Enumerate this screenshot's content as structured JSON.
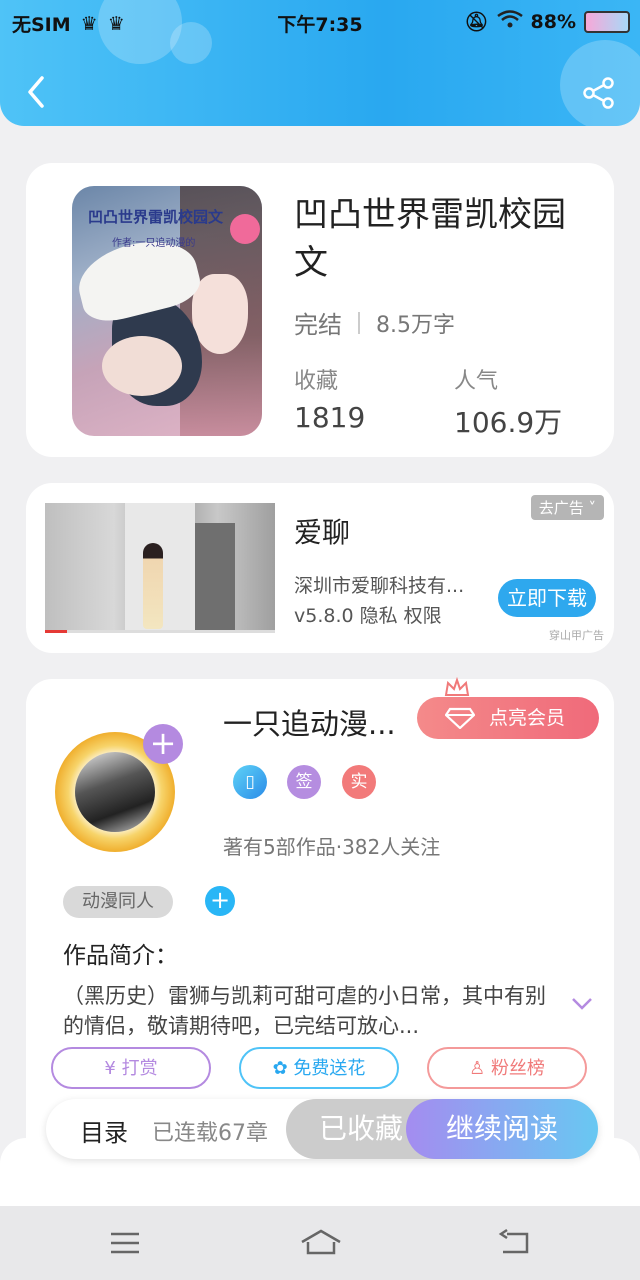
{
  "status_bar": {
    "carrier": "无SIM",
    "time": "下午7:35",
    "battery": "88%"
  },
  "book": {
    "cover_title": "凹凸世界雷凯校园文",
    "cover_author": "作者:一只追动漫的",
    "title": "凹凸世界雷凯校园文",
    "status": "完结",
    "word_count": "8.5万字",
    "favorites_label": "收藏",
    "favorites_value": "1819",
    "popularity_label": "人气",
    "popularity_value": "106.9万"
  },
  "ad": {
    "app_name": "爱聊",
    "company": "深圳市爱聊科技有...",
    "version_line": "v5.8.0  隐私  权限",
    "dismiss_label": "去广告",
    "download_label": "立即下载",
    "source": "穿山甲广告"
  },
  "author": {
    "name": "一只追动漫...",
    "vip_label": "点亮会员",
    "badge_sign": "签",
    "badge_real": "实",
    "info": "著有5部作品·382人关注",
    "tag": "动漫同人",
    "intro_title": "作品简介：",
    "intro_text": "（黑历史）雷狮与凯莉可甜可虐的小日常，其中有别的情侣，敬请期待吧，已完结可放心...",
    "actions": {
      "tip": "打赏",
      "flower": "免费送花",
      "fans": "粉丝榜"
    }
  },
  "bottom_bar": {
    "toc_label": "目录",
    "chapters": "已连载67章",
    "collected_label": "已收藏",
    "read_label": "继续阅读"
  },
  "colors": {
    "header": "#29a8f0",
    "vip": "#f06a7a",
    "read_button": "#a48cf0"
  }
}
